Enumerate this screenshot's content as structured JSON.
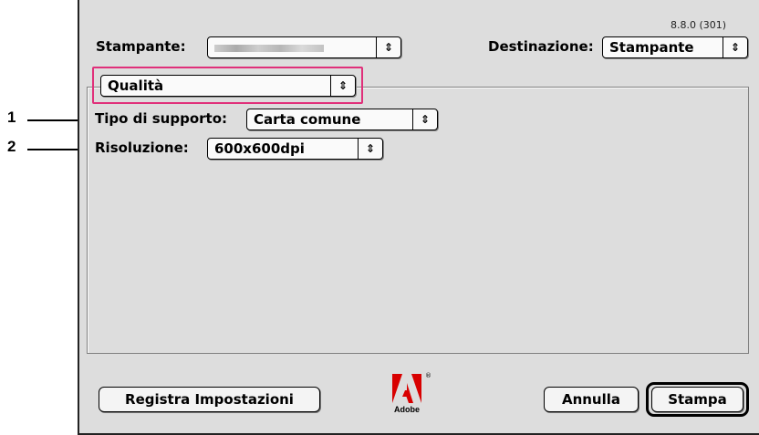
{
  "dialog": {
    "version": "8.8.0 (301)",
    "printer_label": "Stampante:",
    "printer_value_redacted": "",
    "destination_label": "Destinazione:",
    "destination_value": "Stampante",
    "panel_value": "Qualità",
    "media_label": "Tipo di supporto:",
    "media_value": "Carta comune",
    "resolution_label": "Risoluzione:",
    "resolution_value": "600x600dpi",
    "save_settings_label": "Registra Impostazioni",
    "cancel_label": "Annulla",
    "print_label": "Stampa",
    "logo_text": "Adobe",
    "arrow_glyph": "⇕"
  },
  "callouts": {
    "one": "1",
    "two": "2"
  },
  "colors": {
    "highlight": "#e0307a",
    "adobe_red": "#d80000",
    "dialog_bg": "#dddddd"
  }
}
